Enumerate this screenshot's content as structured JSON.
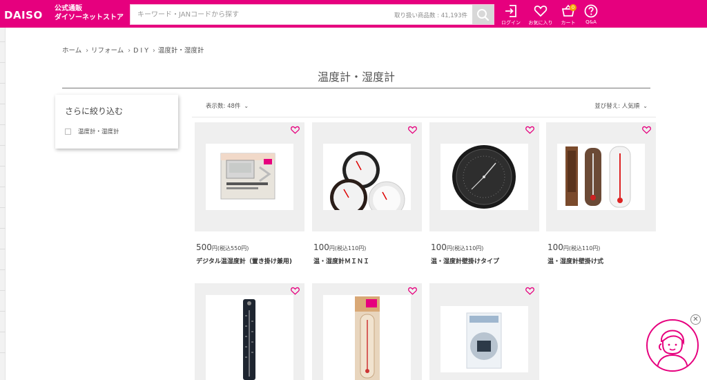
{
  "header": {
    "brand_line1": "公式通販",
    "brand_line2": "ダイソーネットストア",
    "logo_text": "DAISO",
    "search_placeholder": "キーワード・JANコードから探す",
    "item_count": "取り扱い商品数 : 41,193件",
    "icons": [
      {
        "label": "ログイン",
        "icon": "login-icon"
      },
      {
        "label": "お気に入り",
        "icon": "heart-icon"
      },
      {
        "label": "カート",
        "icon": "cart-icon",
        "badge": "0"
      },
      {
        "label": "Q&A",
        "icon": "question-icon"
      }
    ],
    "accent": "#e6007e"
  },
  "breadcrumb": [
    "ホーム",
    "リフォーム",
    "D I Y",
    "温度計・湿度計"
  ],
  "page_title": "温度計・湿度計",
  "filter": {
    "title": "さらに絞り込む",
    "options": [
      {
        "label": "温度計・湿度計",
        "checked": false
      }
    ]
  },
  "toolbar": {
    "per_page": "表示数: 48件",
    "sort": "並び替え: 人気順"
  },
  "products": [
    {
      "price": "500",
      "unit": "円",
      "tax": "(税込550円)",
      "name": "デジタル温湿度計（置き掛け兼用)"
    },
    {
      "price": "100",
      "unit": "円",
      "tax": "(税込110円)",
      "name": "温・湿度計ＭＩＮＩ"
    },
    {
      "price": "100",
      "unit": "円",
      "tax": "(税込110円)",
      "name": "温・湿度計壁掛けタイプ"
    },
    {
      "price": "100",
      "unit": "円",
      "tax": "(税込110円)",
      "name": "温・湿度計壁掛け式"
    },
    {
      "price": "",
      "unit": "",
      "tax": "",
      "name": ""
    },
    {
      "price": "",
      "unit": "",
      "tax": "",
      "name": ""
    },
    {
      "price": "",
      "unit": "",
      "tax": "",
      "name": ""
    }
  ]
}
